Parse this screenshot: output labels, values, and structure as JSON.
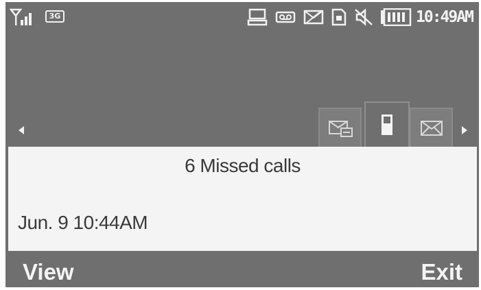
{
  "status_bar": {
    "network": "3G",
    "time": "10:49AM",
    "icons": [
      "signal-icon",
      "computer-icon",
      "voicemail-icon",
      "message-blocked-icon",
      "sim-icon",
      "mute-icon",
      "battery-icon"
    ]
  },
  "tabs": [
    {
      "name": "missed-calls-tab",
      "icon": "missed-call-icon"
    },
    {
      "name": "calls-tab",
      "icon": "phone-icon",
      "selected": true
    },
    {
      "name": "messages-tab",
      "icon": "envelope-icon"
    }
  ],
  "notification": {
    "title": "6 Missed calls",
    "timestamp": "Jun. 9 10:44AM"
  },
  "softkeys": {
    "left": "View",
    "right": "Exit"
  },
  "colors": {
    "background": "#6f6f6f",
    "panel": "#f4f4f4",
    "text_light": "#f2f2f2",
    "text_dark": "#3a3a3a"
  }
}
